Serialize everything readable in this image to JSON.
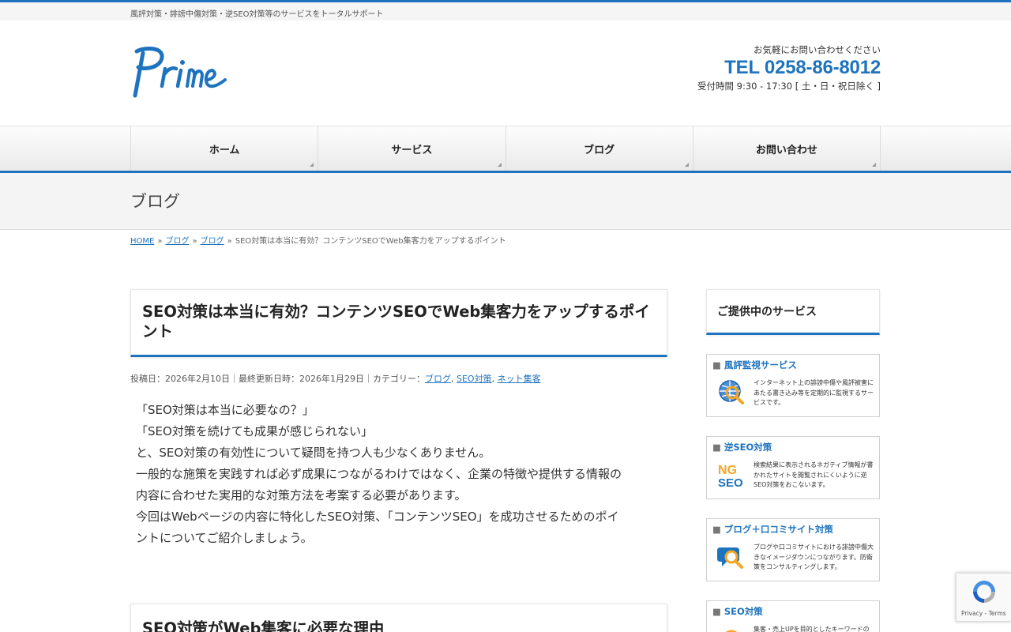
{
  "tagline": "風評対策・誹謗中傷対策・逆SEO対策等のサービスをトータルサポート",
  "logo": {
    "alt": "Prime"
  },
  "contact": {
    "lead": "お気軽にお問い合わせください",
    "tel": "TEL 0258-86-8012",
    "hours": "受付時間 9:30 - 17:30 [ 土・日・祝日除く ]"
  },
  "nav": {
    "items": [
      {
        "label": "ホーム"
      },
      {
        "label": "サービス"
      },
      {
        "label": "ブログ"
      },
      {
        "label": "お問い合わせ"
      }
    ]
  },
  "page_title": "ブログ",
  "breadcrumb": {
    "items": [
      "HOME",
      "ブログ",
      "ブログ"
    ],
    "separator": "»",
    "current": "SEO対策は本当に有効？コンテンツSEOでWeb集客力をアップするポイント"
  },
  "article": {
    "title": "SEO対策は本当に有効？コンテンツSEOでWeb集客力をアップするポイント",
    "meta": {
      "posted": "投稿日：2026年2月10日｜最終更新日時：2026年1月29日｜カテゴリー：",
      "categories": [
        "ブログ",
        "SEO対策",
        "ネット集客"
      ]
    },
    "paragraphs": [
      "「SEO対策は本当に必要なの？」",
      "「SEO対策を続けても成果が感じられない」",
      "と、SEO対策の有効性について疑問を持つ人も少なくありません。",
      "一般的な施策を実践すれば必ず成果につながるわけではなく、企業の特徴や提供する情報の",
      "内容に合わせた実用的な対策方法を考案する必要があります。",
      "今回はWebページの内容に特化したSEO対策、「コンテンツSEO」を成功させるためのポイ",
      "ントについてご紹介しましょう。"
    ],
    "next_heading": "SEO対策がWeb集客に必要な理由"
  },
  "sidebar": {
    "title": "ご提供中のサービス",
    "services": [
      {
        "title": "風評監視サービス",
        "icon": "globe-search-icon",
        "desc": "インターネット上の誹謗中傷や風評被害にあたる書き込み等を定期的に監視するサービスです。"
      },
      {
        "title": "逆SEO対策",
        "icon": "ng-seo-icon",
        "desc": "検索結果に表示されるネガティブ情報が書かれたサイトを閲覧されにくいように逆SEO対策をおこないます。"
      },
      {
        "title": "ブログ＋口コミサイト対策",
        "icon": "speech-magnifier-icon",
        "desc": "ブログや口コミサイトにおける誹謗中傷大きなイメージダウンにつながります。防衛策をコンサルティングします。"
      },
      {
        "title": "SEO対策",
        "icon": "seo-icon",
        "desc": "集客・売上UPを目的としたキーワードの"
      }
    ],
    "icon_text": {
      "ng": "NG",
      "seo": "SEO"
    }
  },
  "recaptcha": {
    "links": "Privacy - Terms"
  },
  "colors": {
    "accent": "#1e73be",
    "orange": "#f5a623"
  }
}
